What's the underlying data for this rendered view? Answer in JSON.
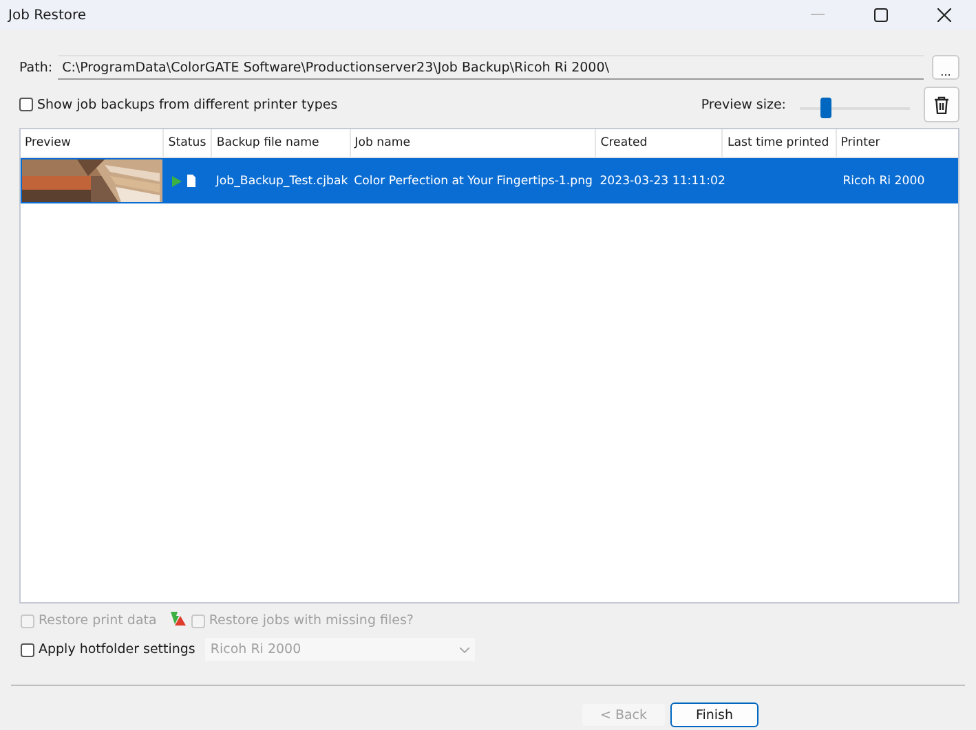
{
  "window": {
    "title": "Job Restore"
  },
  "path": {
    "label": "Path:",
    "value": "C:\\ProgramData\\ColorGATE Software\\Productionserver23\\Job Backup\\Ricoh Ri 2000\\",
    "browse_button": "..."
  },
  "show_other_types": {
    "label": "Show job backups from different printer types",
    "checked": false
  },
  "preview_size": {
    "label": "Preview size:",
    "level": 0.24
  },
  "table": {
    "columns": [
      "Preview",
      "Status",
      "Backup file name",
      "Job name",
      "Created",
      "Last time printed",
      "Printer"
    ],
    "rows": [
      {
        "backup_file": "Job_Backup_Test.cjbak",
        "job_name": "Color Perfection at Your Fingertips-1.png",
        "created": "2023-03-23 11:11:02",
        "printer": "Ricoh Ri 2000",
        "selected": true
      }
    ]
  },
  "restore_print_data": {
    "label": "Restore print data",
    "checked": false,
    "disabled": true
  },
  "restore_missing": {
    "label": "Restore jobs with missing files?",
    "checked": false,
    "disabled": true
  },
  "apply_hotfolder": {
    "label": "Apply hotfolder settings",
    "checked": false,
    "disabled": false
  },
  "hotfolder_select": {
    "value": "Ricoh Ri 2000",
    "disabled": true
  },
  "buttons": [
    {
      "label": "< Back",
      "disabled": true
    },
    {
      "label": "Finish",
      "disabled": false
    }
  ]
}
